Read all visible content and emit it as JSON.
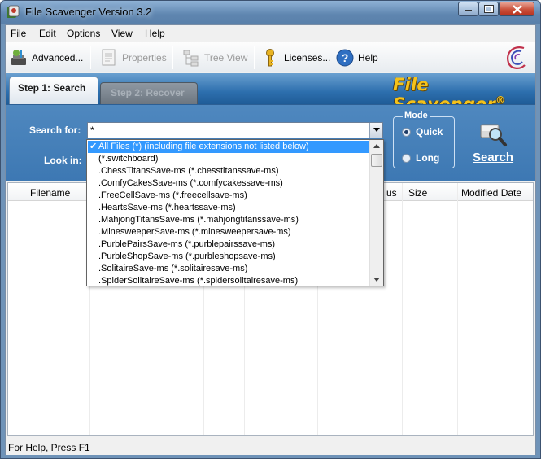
{
  "window": {
    "title": "File Scavenger Version 3.2"
  },
  "menu": [
    "File",
    "Edit",
    "Options",
    "View",
    "Help"
  ],
  "toolbar": {
    "advanced": "Advanced...",
    "properties": "Properties",
    "tree_view": "Tree View",
    "licenses": "Licenses...",
    "help": "Help"
  },
  "tabs": {
    "step1": "Step 1: Search",
    "step2": "Step 2: Recover"
  },
  "brand": {
    "name": "File Scavenger",
    "mark": "®"
  },
  "search": {
    "search_for_label": "Search for:",
    "search_for_value": "*",
    "look_in_label": "Look in:",
    "mode_title": "Mode",
    "mode_quick": "Quick",
    "mode_long": "Long",
    "mode_selected": "Quick",
    "search_button": "Search"
  },
  "columns": [
    "Filename",
    "us",
    "Size",
    "Modified Date"
  ],
  "dropdown": {
    "items": [
      "All Files (*) (including file extensions not listed below)",
      "(*.switchboard)",
      ".ChessTitansSave-ms (*.chesstitanssave-ms)",
      ".ComfyCakesSave-ms (*.comfycakessave-ms)",
      ".FreeCellSave-ms (*.freecellsave-ms)",
      ".HeartsSave-ms (*.heartssave-ms)",
      ".MahjongTitansSave-ms (*.mahjongtitanssave-ms)",
      ".MinesweeperSave-ms (*.minesweepersave-ms)",
      ".PurblePairsSave-ms (*.purblepairssave-ms)",
      ".PurbleShopSave-ms (*.purbleshopsave-ms)",
      ".SolitaireSave-ms (*.solitairesave-ms)",
      ".SpiderSolitaireSave-ms (*.spidersolitairesave-ms)"
    ],
    "selected_index": 0
  },
  "status": {
    "text": "For Help, Press F1"
  },
  "colors": {
    "accent_blue": "#3d78b3",
    "brand_yellow": "#f5c21a",
    "selection": "#3399ff"
  }
}
